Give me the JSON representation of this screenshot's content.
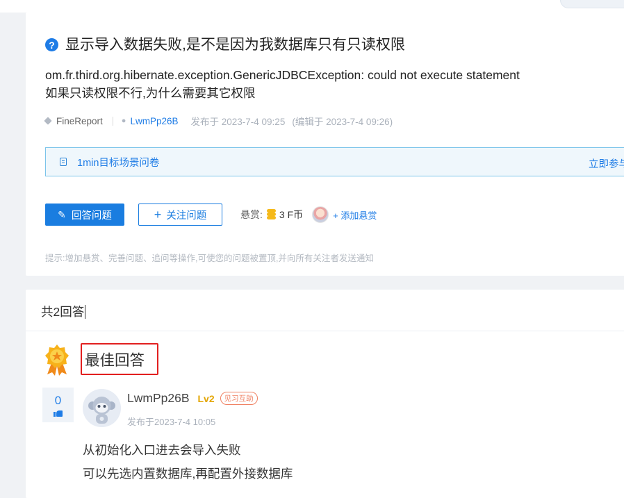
{
  "topbar": {
    "clipped_left_text": "...",
    "clipped_title": "..."
  },
  "question": {
    "title": "显示导入数据失败,是不是因为我数据库只有只读权限",
    "body_lines": [
      "om.fr.third.org.hibernate.exception.GenericJDBCException: could not execute statement",
      "如果只读权限不行,为什么需要其它权限"
    ],
    "tag": "FineReport",
    "author": "LwmPp26B",
    "posted": "发布于 2023-7-4 09:25",
    "edited": "(编辑于 2023-7-4 09:26)",
    "survey": {
      "text": "1min目标场景问卷",
      "link": "立即参与"
    },
    "actions": {
      "answer_label": "回答问题",
      "follow_label": "关注问题",
      "reward_label": "悬赏:",
      "reward_amount": "3 F币",
      "add_reward_label": "+ 添加悬赏"
    },
    "hint": "提示:增加悬赏、完善问题、追问等操作,可使您的问题被置顶,并向所有关注者发送通知"
  },
  "answers": {
    "count_label": "共2回答",
    "best_label": "最佳回答",
    "best": {
      "votes": "0",
      "username": "LwmPp26B",
      "level": "Lv2",
      "badge": "见习互助",
      "time": "发布于2023-7-4 10:05",
      "lines": [
        "从初始化入口进去会导入失败",
        "可以先选内置数据库,再配置外接数据库"
      ]
    }
  },
  "colors": {
    "accent": "#1a7de0",
    "highlight_border": "#e21f1f",
    "page_bg": "#f0f2f5"
  }
}
